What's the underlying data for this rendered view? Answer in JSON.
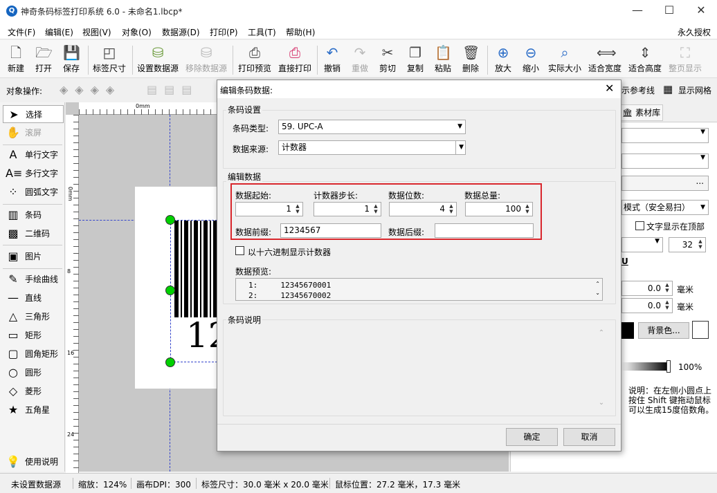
{
  "window": {
    "title": "神奇条码标签打印系统 6.0 - 未命名1.lbcp*",
    "app_icon": "Q",
    "minimize": "—",
    "maximize": "☐",
    "close": "✕"
  },
  "menu": {
    "items": [
      "文件(F)",
      "编辑(E)",
      "视图(V)",
      "对象(O)",
      "数据源(D)",
      "打印(P)",
      "工具(T)",
      "帮助(H)"
    ],
    "license": "永久授权"
  },
  "toolbar": {
    "buttons": [
      "新建",
      "打开",
      "保存",
      "标签尺寸",
      "设置数据源",
      "移除数据源",
      "打印预览",
      "直接打印",
      "撤销",
      "重做",
      "剪切",
      "复制",
      "粘贴",
      "删除",
      "放大",
      "缩小",
      "实际大小",
      "适合宽度",
      "适合高度",
      "整页显示"
    ]
  },
  "objbar": {
    "label": "对象操作:",
    "ref_line": "示参考线",
    "grid": "显示网格"
  },
  "left_panel": {
    "items": [
      "选择",
      "滚屏",
      "单行文字",
      "多行文字",
      "圆弧文字",
      "条码",
      "二维码",
      "图片",
      "手绘曲线",
      "直线",
      "三角形",
      "矩形",
      "圆角矩形",
      "圆形",
      "菱形",
      "五角星",
      "使用说明"
    ]
  },
  "ruler": {
    "origin": "0mm",
    "v_marks": [
      "0mm",
      "8",
      "16",
      "24"
    ]
  },
  "canvas": {
    "barcode_text": "12"
  },
  "right_panel": {
    "tab": "素材库",
    "readability": "模式（安全易扫）",
    "top_text": "文字显示在顶部",
    "font_size": "32",
    "underline": "U",
    "offset1": "0.0",
    "offset2": "0.0",
    "unit": "毫米",
    "bg_color": "背景色...",
    "opacity": "100%",
    "help": "说明：在左侧小圆点上按住 Shift 键拖动鼠标可以生成15度倍数角。",
    "ellipsis": "..."
  },
  "status": {
    "datasource": "未设置数据源",
    "zoom": "缩放：124%",
    "dpi": "画布DPI：300",
    "size": "标签尺寸：30.0 毫米 x 20.0 毫米",
    "mouse": "鼠标位置：27.2 毫米，17.3 毫米"
  },
  "dialog": {
    "title": "编辑条码数据:",
    "group_barcode": "条码设置",
    "type_label": "条码类型:",
    "type_value": "59. UPC-A",
    "source_label": "数据来源:",
    "source_value": "计数器",
    "group_data": "编辑数据",
    "start_label": "数据起始:",
    "start_value": "1",
    "step_label": "计数器步长:",
    "step_value": "1",
    "digits_label": "数据位数:",
    "digits_value": "4",
    "total_label": "数据总量:",
    "total_value": "100",
    "prefix_label": "数据前缀:",
    "prefix_value": "1234567",
    "suffix_label": "数据后缀:",
    "suffix_value": "",
    "hex_label": "以十六进制显示计数器",
    "preview_label": "数据预览:",
    "preview_rows": [
      "1:     12345670001",
      "2:     12345670002"
    ],
    "group_desc": "条码说明",
    "ok": "确定",
    "cancel": "取消",
    "highlight_color": "#d9262c"
  }
}
